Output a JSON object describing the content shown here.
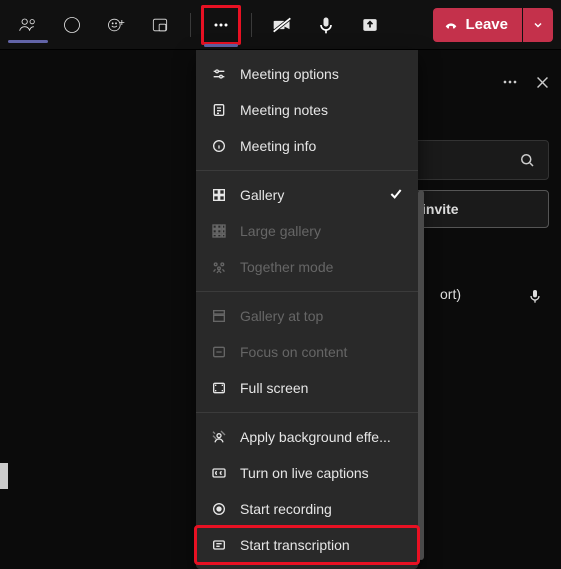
{
  "toolbar": {
    "leave_label": "Leave"
  },
  "panel": {
    "invite_label": "invite",
    "participant_suffix": "ort)"
  },
  "menu": {
    "meeting_options": "Meeting options",
    "meeting_notes": "Meeting notes",
    "meeting_info": "Meeting info",
    "gallery": "Gallery",
    "large_gallery": "Large gallery",
    "together_mode": "Together mode",
    "gallery_at_top": "Gallery at top",
    "focus_content": "Focus on content",
    "full_screen": "Full screen",
    "apply_bg": "Apply background effe...",
    "live_captions": "Turn on live captions",
    "start_recording": "Start recording",
    "start_transcription": "Start transcription"
  }
}
